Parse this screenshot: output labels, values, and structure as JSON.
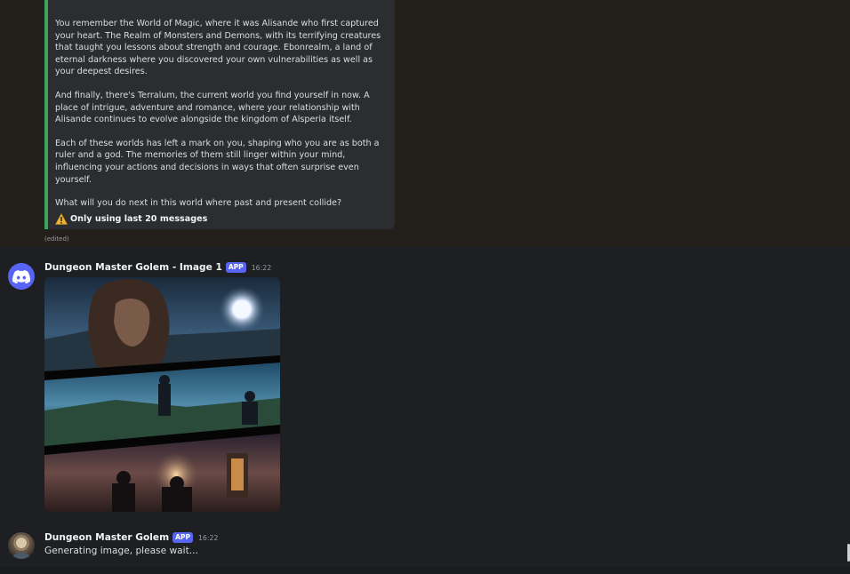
{
  "embed": {
    "paragraphs": [
      "You remember the World of Magic, where it was Alisande who first captured your heart. The Realm of Monsters and Demons, with its terrifying creatures that taught you lessons about strength and courage. Ebonrealm, a land of eternal darkness where you discovered your own vulnerabilities as well as your deepest desires.",
      "And finally, there's Terralum, the current world you find yourself in now. A place of intrigue, adventure and romance, where your relationship with Alisande continues to evolve alongside the kingdom of Alsperia itself.",
      "Each of these worlds has left a mark on you, shaping who you are as both a ruler and a god. The memories of them still linger within your mind, influencing your actions and decisions in ways that often surprise even yourself."
    ],
    "question": "What will you do next in this world where past and present collide?",
    "warning": "Only using last 20 messages",
    "warning_icon": "warning-icon",
    "border_color": "#3ba55c"
  },
  "edited_label": "(edited)",
  "messages": [
    {
      "username": "Dungeon Master Golem - Image 1",
      "badge": "APP",
      "time": "16:22",
      "avatar_icon": "discord-logo-icon",
      "image_alt": "Three fantasy panels: a woman gazing at a glowing moon by the sea, armored figures on a misty plain, and travelers by lantern light near ruins"
    },
    {
      "username": "Dungeon Master Golem",
      "badge": "APP",
      "time": "16:22",
      "avatar_icon": "golem-avatar",
      "text": "Generating image, please wait..."
    }
  ],
  "colors": {
    "accent": "#5865f2",
    "background": "#1e1f22",
    "highlight": "#231f1a",
    "embed": "#2b2d31"
  }
}
